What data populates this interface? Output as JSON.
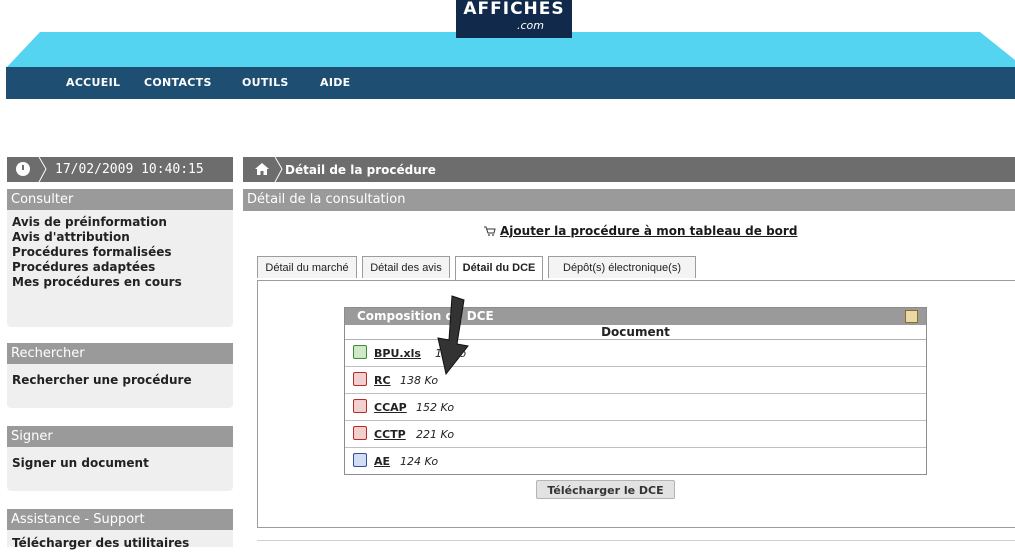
{
  "brand": {
    "logo_text": "AFFICHES",
    "logo_suffix": ".com"
  },
  "colors": {
    "banner_light": "#55d4f2",
    "nav_dark": "#1e4f73",
    "header_grey": "#9a9a9a",
    "bar_grey": "#6d6d6d"
  },
  "nav": {
    "items": [
      {
        "label": "ACCUEIL"
      },
      {
        "label": "CONTACTS"
      },
      {
        "label": "OUTILS"
      },
      {
        "label": "AIDE"
      }
    ]
  },
  "datebar": {
    "datetime": "17/02/2009 10:40:15",
    "icon": "clock-icon"
  },
  "breadcrumb": {
    "label": "Détail de la procédure",
    "icon": "home-icon"
  },
  "sidebar": {
    "sections": [
      {
        "title": "Consulter",
        "items": [
          {
            "label": "Avis de préinformation"
          },
          {
            "label": "Avis d'attribution"
          },
          {
            "label": "Procédures formalisées"
          },
          {
            "label": "Procédures adaptées"
          },
          {
            "label": "Mes procédures en cours"
          }
        ]
      },
      {
        "title": "Rechercher",
        "items": [
          {
            "label": "Rechercher une procédure"
          }
        ]
      },
      {
        "title": "Signer",
        "items": [
          {
            "label": "Signer un document"
          }
        ]
      },
      {
        "title": "Assistance - Support",
        "items": [
          {
            "label": "Télécharger des utilitaires"
          }
        ]
      }
    ]
  },
  "main": {
    "panel_title": "Détail de la consultation",
    "add_link": "Ajouter la procédure à mon tableau de bord",
    "tabs": [
      {
        "label": "Détail du marché"
      },
      {
        "label": "Détail des avis"
      },
      {
        "label": "Détail du DCE",
        "active": true
      },
      {
        "label": "Dépôt(s) électronique(s)"
      }
    ],
    "dce": {
      "title": "Composition du DCE",
      "column": "Document",
      "files": [
        {
          "name": "BPU.xls",
          "size": "15 Ko",
          "type": "xls"
        },
        {
          "name": "RC",
          "size": "138 Ko",
          "type": "pdf"
        },
        {
          "name": "CCAP",
          "size": "152 Ko",
          "type": "pdf"
        },
        {
          "name": "CCTP",
          "size": "221 Ko",
          "type": "pdf"
        },
        {
          "name": "AE",
          "size": "124 Ko",
          "type": "doc"
        }
      ],
      "download_label": "Télécharger le DCE"
    }
  }
}
